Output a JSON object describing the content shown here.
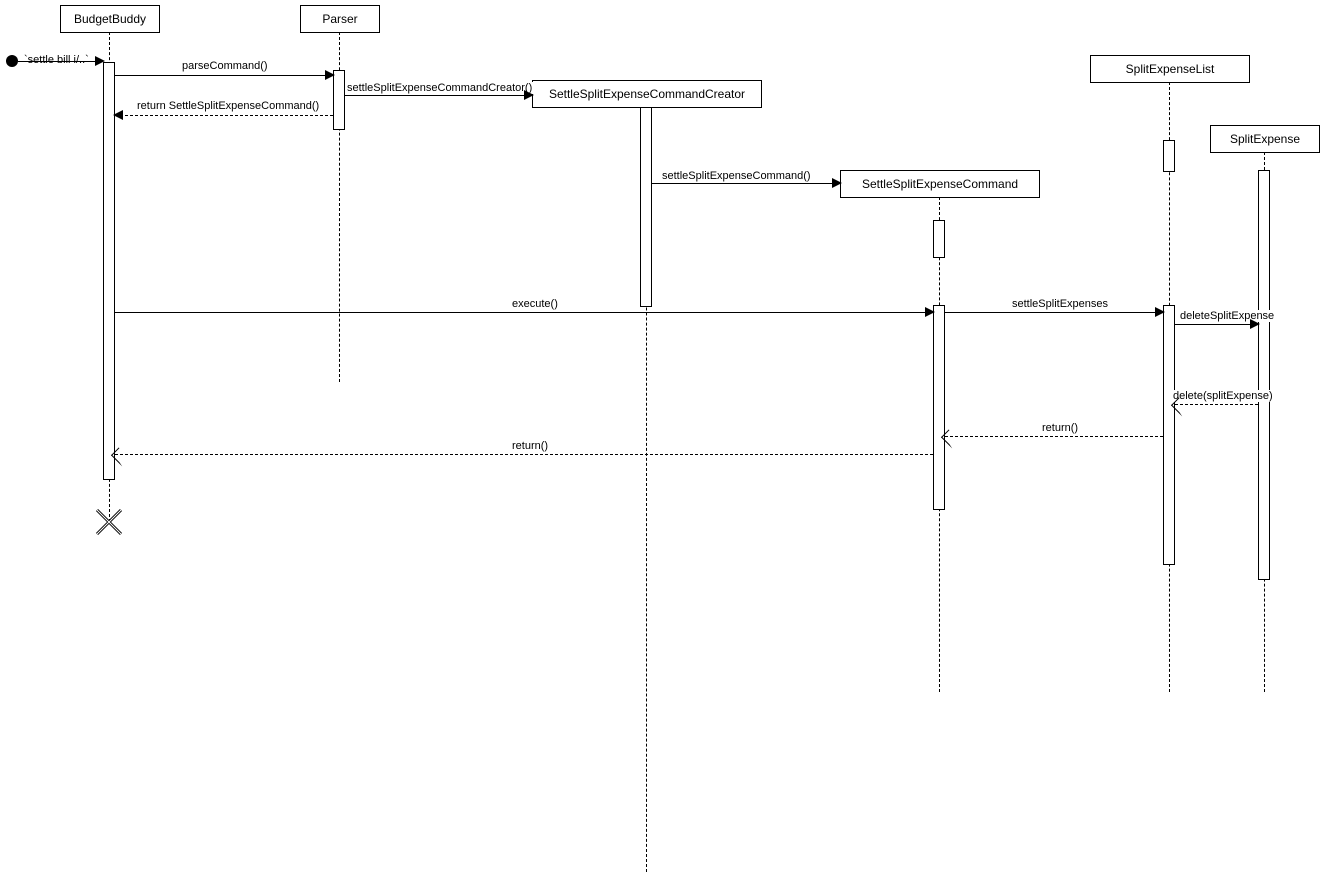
{
  "diagram_type": "sequence",
  "start_message": "`settle bill i/..`",
  "participants": {
    "budgetbuddy": "BudgetBuddy",
    "parser": "Parser",
    "creator": "SettleSplitExpenseCommandCreator",
    "command": "SettleSplitExpenseCommand",
    "list": "SplitExpenseList",
    "expense": "SplitExpense"
  },
  "messages": {
    "parseCommand": "parseCommand()",
    "creatorCall": "settleSplitExpenseCommandCreator()",
    "returnCommand": "return SettleSplitExpenseCommand()",
    "commandCall": "settleSplitExpenseCommand()",
    "execute": "execute()",
    "settle": "settleSplitExpenses",
    "deleteSplit": "deleteSplitExpense",
    "deleteReturn": "delete(splitExpense)",
    "returnList": "return()",
    "returnFinal": "return()"
  },
  "chart_data": {
    "type": "sequence_diagram",
    "participants": [
      "Actor",
      "BudgetBuddy",
      "Parser",
      "SettleSplitExpenseCommandCreator",
      "SettleSplitExpenseCommand",
      "SplitExpenseList",
      "SplitExpense"
    ],
    "messages": [
      {
        "from": "Actor",
        "to": "BudgetBuddy",
        "label": "`settle bill i/..`",
        "type": "sync"
      },
      {
        "from": "BudgetBuddy",
        "to": "Parser",
        "label": "parseCommand()",
        "type": "sync"
      },
      {
        "from": "Parser",
        "to": "SettleSplitExpenseCommandCreator",
        "label": "settleSplitExpenseCommandCreator()",
        "type": "create"
      },
      {
        "from": "Parser",
        "to": "BudgetBuddy",
        "label": "return SettleSplitExpenseCommand()",
        "type": "return"
      },
      {
        "from": "SettleSplitExpenseCommandCreator",
        "to": "SettleSplitExpenseCommand",
        "label": "settleSplitExpenseCommand()",
        "type": "create"
      },
      {
        "from": "BudgetBuddy",
        "to": "SettleSplitExpenseCommand",
        "label": "execute()",
        "type": "sync"
      },
      {
        "from": "SettleSplitExpenseCommand",
        "to": "SplitExpenseList",
        "label": "settleSplitExpenses",
        "type": "sync"
      },
      {
        "from": "SplitExpenseList",
        "to": "SplitExpense",
        "label": "deleteSplitExpense",
        "type": "sync"
      },
      {
        "from": "SplitExpense",
        "to": "SplitExpenseList",
        "label": "delete(splitExpense)",
        "type": "return"
      },
      {
        "from": "SplitExpenseList",
        "to": "SettleSplitExpenseCommand",
        "label": "return()",
        "type": "return"
      },
      {
        "from": "SettleSplitExpenseCommand",
        "to": "BudgetBuddy",
        "label": "return()",
        "type": "return"
      },
      {
        "from": "BudgetBuddy",
        "to": "Actor",
        "label": "",
        "type": "destroy"
      }
    ]
  }
}
